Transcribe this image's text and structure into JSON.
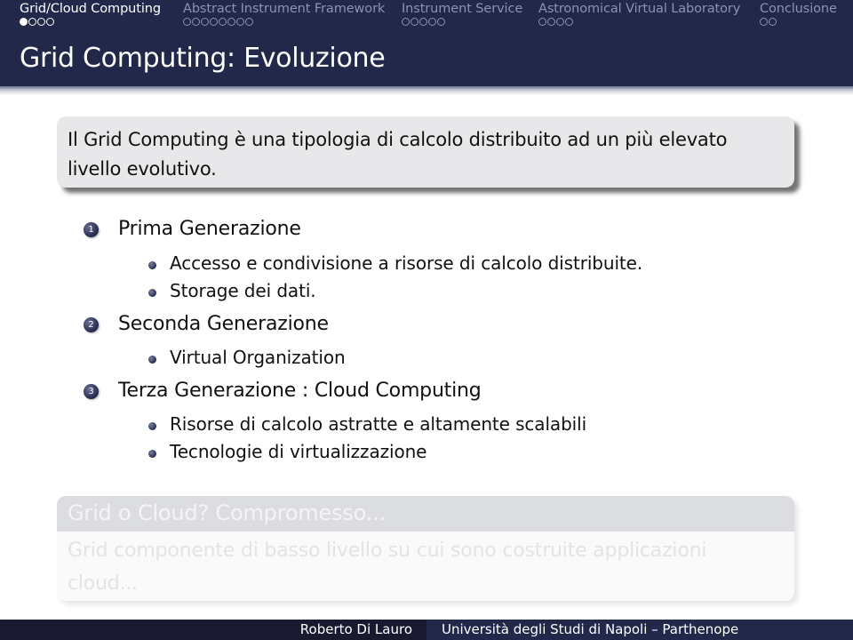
{
  "nav": {
    "sections": [
      {
        "label": "Grid/Cloud Computing",
        "slides": 4,
        "current": 1,
        "active": true
      },
      {
        "label": "Abstract Instrument Framework",
        "slides": 8,
        "current": 0,
        "active": false
      },
      {
        "label": "Instrument Service",
        "slides": 5,
        "current": 0,
        "active": false
      },
      {
        "label": "Astronomical Virtual Laboratory",
        "slides": 4,
        "current": 0,
        "active": false
      },
      {
        "label": "Conclusione",
        "slides": 2,
        "current": 0,
        "active": false
      }
    ]
  },
  "frame": {
    "title": "Grid Computing: Evoluzione"
  },
  "intro_block": {
    "text": "Il Grid Computing è una tipologia di calcolo distribuito ad un più elevato livello evolutivo."
  },
  "enumerate": [
    {
      "number": "1",
      "label": "Prima Generazione",
      "items": [
        "Accesso e condivisione a risorse di calcolo distribuite.",
        "Storage dei dati."
      ]
    },
    {
      "number": "2",
      "label": "Seconda Generazione",
      "items": [
        "Virtual Organization"
      ]
    },
    {
      "number": "3",
      "label": "Terza Generazione : Cloud Computing",
      "items": [
        "Risorse di calcolo astratte e altamente scalabili",
        "Tecnologie di virtualizzazione"
      ]
    }
  ],
  "uncovered_block": {
    "title": "Grid o Cloud? Compromesso...",
    "text": "Grid componente di basso livello su cui sono costruite applicazioni cloud..."
  },
  "footer": {
    "author": "Roberto Di Lauro",
    "institution": "Università degli Studi di Napoli – Parthenope"
  },
  "colors": {
    "theme": "#22284a",
    "footer_dark": "#191a30",
    "block_bg": "#e8e8ea"
  }
}
